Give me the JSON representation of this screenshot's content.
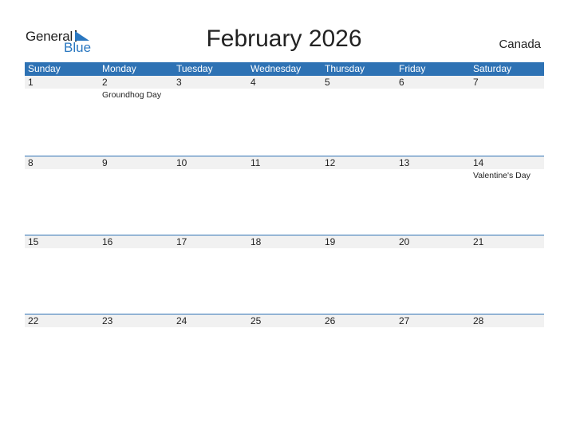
{
  "brand": {
    "line1": "General",
    "line2": "Blue"
  },
  "title": "February 2026",
  "country": "Canada",
  "colors": {
    "header": "#2e72b4",
    "brand_blue": "#2a77c0",
    "day_bg": "#f1f1f1"
  },
  "weekdays": [
    "Sunday",
    "Monday",
    "Tuesday",
    "Wednesday",
    "Thursday",
    "Friday",
    "Saturday"
  ],
  "weeks": [
    {
      "days": [
        {
          "n": "1",
          "e": ""
        },
        {
          "n": "2",
          "e": "Groundhog Day"
        },
        {
          "n": "3",
          "e": ""
        },
        {
          "n": "4",
          "e": ""
        },
        {
          "n": "5",
          "e": ""
        },
        {
          "n": "6",
          "e": ""
        },
        {
          "n": "7",
          "e": ""
        }
      ]
    },
    {
      "days": [
        {
          "n": "8",
          "e": ""
        },
        {
          "n": "9",
          "e": ""
        },
        {
          "n": "10",
          "e": ""
        },
        {
          "n": "11",
          "e": ""
        },
        {
          "n": "12",
          "e": ""
        },
        {
          "n": "13",
          "e": ""
        },
        {
          "n": "14",
          "e": "Valentine's Day"
        }
      ]
    },
    {
      "days": [
        {
          "n": "15",
          "e": ""
        },
        {
          "n": "16",
          "e": ""
        },
        {
          "n": "17",
          "e": ""
        },
        {
          "n": "18",
          "e": ""
        },
        {
          "n": "19",
          "e": ""
        },
        {
          "n": "20",
          "e": ""
        },
        {
          "n": "21",
          "e": ""
        }
      ]
    },
    {
      "days": [
        {
          "n": "22",
          "e": ""
        },
        {
          "n": "23",
          "e": ""
        },
        {
          "n": "24",
          "e": ""
        },
        {
          "n": "25",
          "e": ""
        },
        {
          "n": "26",
          "e": ""
        },
        {
          "n": "27",
          "e": ""
        },
        {
          "n": "28",
          "e": ""
        }
      ]
    }
  ]
}
